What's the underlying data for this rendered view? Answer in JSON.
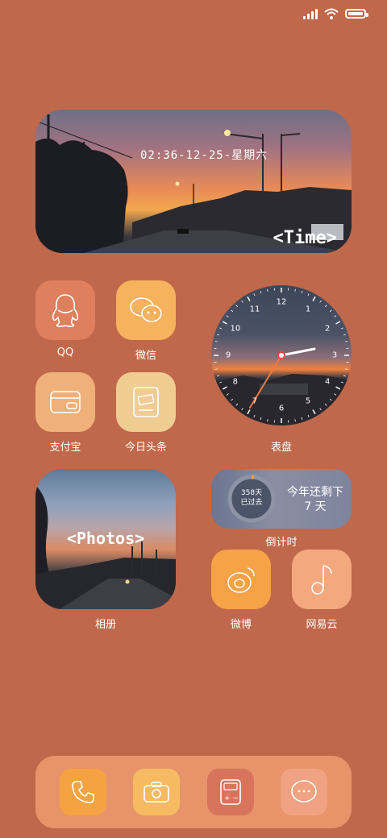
{
  "status_bar": {
    "signal_icon": "signal-bars-icon",
    "wifi_icon": "wifi-icon",
    "battery_icon": "battery-icon",
    "battery_level": 1.0
  },
  "time_widget": {
    "datetime": "02:36-12-25-星期六",
    "tag": "<Time>"
  },
  "apps": {
    "qq": {
      "label": "QQ",
      "icon": "qq-penguin-icon",
      "color": "#df7f5e"
    },
    "wechat": {
      "label": "微信",
      "icon": "wechat-bubbles-icon",
      "color": "#f7b25d"
    },
    "alipay": {
      "label": "支付宝",
      "icon": "wallet-card-icon",
      "color": "#f0b07a"
    },
    "toutiao": {
      "label": "今日头条",
      "icon": "newspaper-icon",
      "color": "#efcc92"
    },
    "weibo": {
      "label": "微博",
      "icon": "weibo-icon",
      "color": "#f6a348"
    },
    "netease": {
      "label": "网易云",
      "icon": "music-note-icon",
      "color": "#f3a87e"
    }
  },
  "clock": {
    "label": "表盘",
    "numbers": [
      "12",
      "1",
      "2",
      "3",
      "4",
      "5",
      "6",
      "7",
      "8",
      "9",
      "10",
      "11"
    ]
  },
  "countdown": {
    "label": "倒计时",
    "ring_days": "358天",
    "ring_sub": "已过去",
    "title": "今年还剩下",
    "remaining": "7 天"
  },
  "photos": {
    "label": "相册",
    "tag": "<Photos>"
  },
  "dock": [
    {
      "icon": "phone-icon",
      "color": "#f5a342"
    },
    {
      "icon": "camera-icon",
      "color": "#f6bb62"
    },
    {
      "icon": "calculator-icon",
      "color": "#d9745c"
    },
    {
      "icon": "message-icon",
      "color": "#f0a282"
    }
  ]
}
